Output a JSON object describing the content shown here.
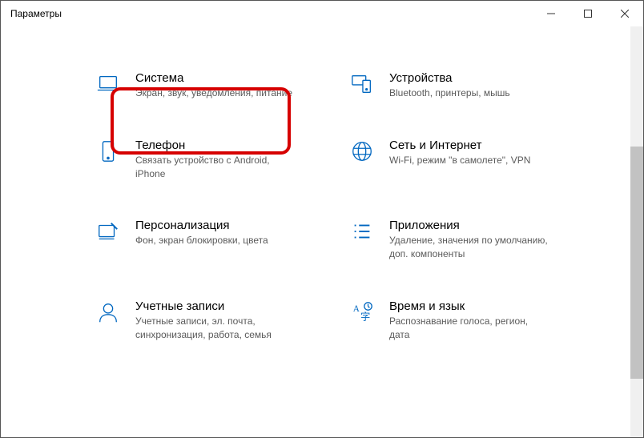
{
  "window": {
    "title": "Параметры"
  },
  "tiles": [
    {
      "id": "system",
      "title": "Система",
      "desc": "Экран, звук, уведомления, питание"
    },
    {
      "id": "devices",
      "title": "Устройства",
      "desc": "Bluetooth, принтеры, мышь"
    },
    {
      "id": "phone",
      "title": "Телефон",
      "desc": "Связать устройство с Android, iPhone"
    },
    {
      "id": "network",
      "title": "Сеть и Интернет",
      "desc": "Wi-Fi, режим \"в самолете\", VPN"
    },
    {
      "id": "personalization",
      "title": "Персонализация",
      "desc": "Фон, экран блокировки, цвета"
    },
    {
      "id": "apps",
      "title": "Приложения",
      "desc": "Удаление, значения по умолчанию, доп. компоненты"
    },
    {
      "id": "accounts",
      "title": "Учетные записи",
      "desc": "Учетные записи, эл. почта, синхронизация, работа, семья"
    },
    {
      "id": "time",
      "title": "Время и язык",
      "desc": "Распознавание голоса, регион, дата"
    }
  ]
}
